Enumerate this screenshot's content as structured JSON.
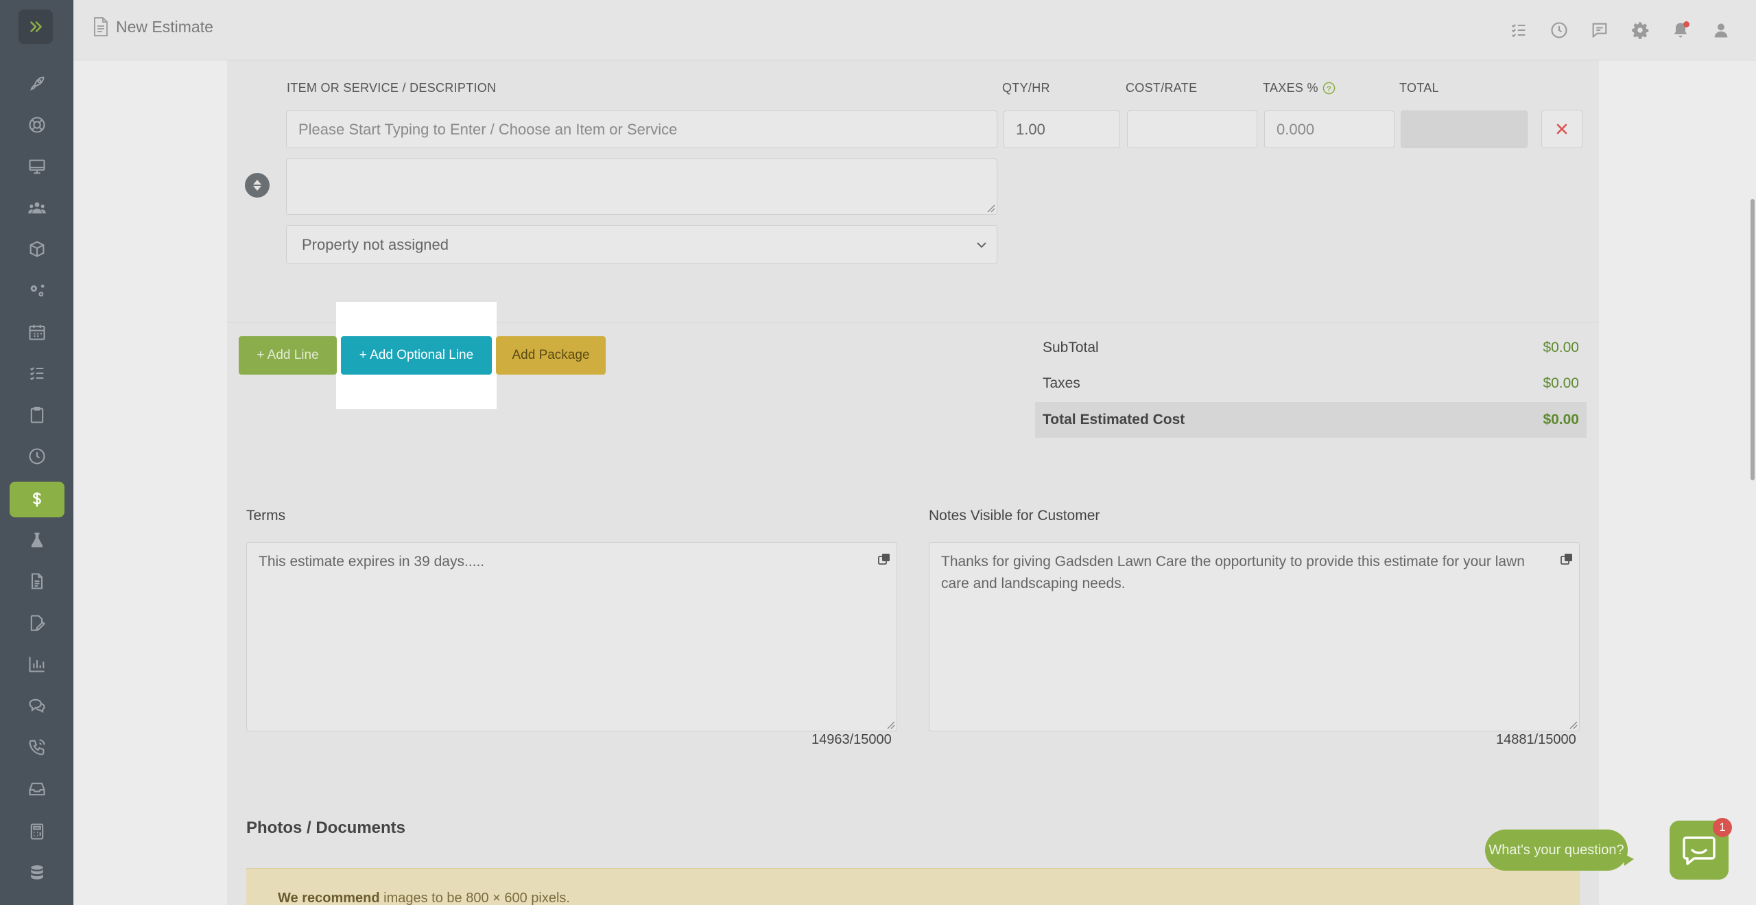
{
  "header": {
    "title": "New Estimate"
  },
  "sidebar": {
    "items": [
      {
        "icon": "rocket-icon"
      },
      {
        "icon": "lifebuoy-icon"
      },
      {
        "icon": "monitor-icon"
      },
      {
        "icon": "users-icon"
      },
      {
        "icon": "box-icon"
      },
      {
        "icon": "gears-icon"
      },
      {
        "icon": "calendar-icon"
      },
      {
        "icon": "checklist-icon"
      },
      {
        "icon": "clipboard-icon"
      },
      {
        "icon": "clock-icon"
      },
      {
        "icon": "dollar-icon",
        "active": true
      },
      {
        "icon": "flask-icon"
      },
      {
        "icon": "document-icon"
      },
      {
        "icon": "signature-icon"
      },
      {
        "icon": "bar-chart-icon"
      },
      {
        "icon": "chat-bubbles-icon"
      },
      {
        "icon": "phone-icon"
      },
      {
        "icon": "inbox-icon"
      },
      {
        "icon": "calculator-icon"
      },
      {
        "icon": "database-icon"
      }
    ]
  },
  "line_items": {
    "columns": {
      "item": "ITEM OR SERVICE / DESCRIPTION",
      "qty": "QTY/HR",
      "cost": "COST/RATE",
      "taxes": "TAXES %",
      "total": "TOTAL"
    },
    "row": {
      "item_placeholder": "Please Start Typing to Enter / Choose an Item or Service",
      "qty": "1.00",
      "cost": "",
      "taxes_placeholder": "0.000",
      "total": "",
      "description": "",
      "property": "Property not assigned"
    }
  },
  "buttons": {
    "add_line": "+ Add Line",
    "add_optional_line": "+ Add Optional Line",
    "add_package": "Add Package"
  },
  "totals": {
    "subtotal_label": "SubTotal",
    "subtotal": "$0.00",
    "taxes_label": "Taxes",
    "taxes": "$0.00",
    "total_label": "Total Estimated Cost",
    "total": "$0.00"
  },
  "terms": {
    "label": "Terms",
    "text": "This estimate expires in 39 days.....",
    "counter": "14963/15000"
  },
  "notes": {
    "label": "Notes Visible for Customer",
    "text": "Thanks for giving Gadsden Lawn Care the opportunity to provide this estimate for your lawn care and landscaping needs.",
    "counter": "14881/15000"
  },
  "photos": {
    "title": "Photos / Documents",
    "recommend_bold": "We recommend",
    "recommend_rest": " images to be 800 × 600 pixels."
  },
  "chat": {
    "prompt": "What's your question?",
    "badge": "1"
  },
  "colors": {
    "accent_green": "#8bb046",
    "blue": "#1aa5b8",
    "yellow": "#cfae3f",
    "red": "#d9534f"
  }
}
